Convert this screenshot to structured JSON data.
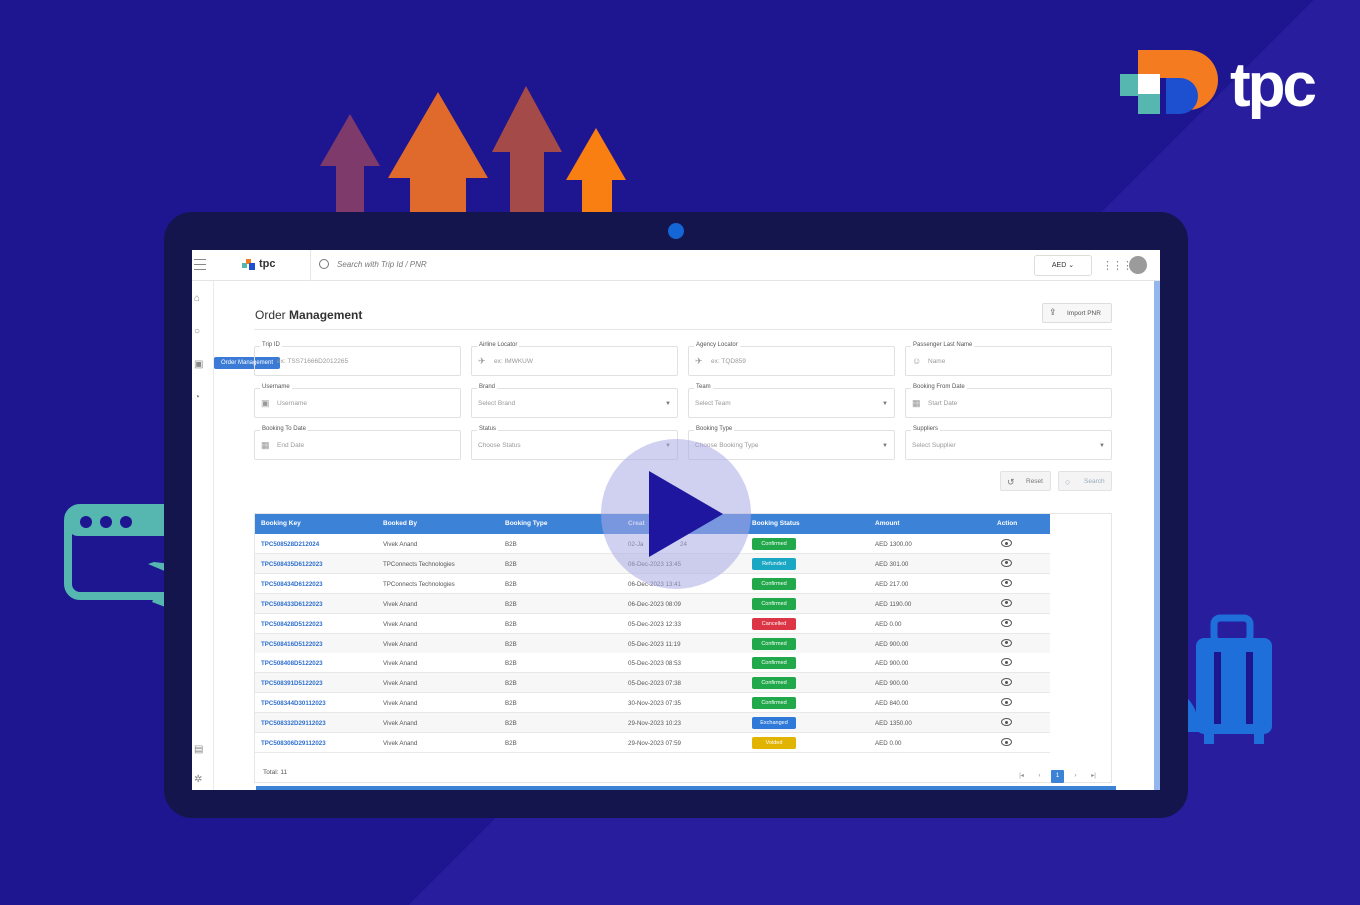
{
  "brand": {
    "name": "tpc"
  },
  "app": {
    "logo_text": "tpc",
    "search_placeholder": "Search with Trip Id / PNR",
    "currency": "AED",
    "page_title_prefix": "Order",
    "page_title": "Management",
    "import_label": "Import PNR",
    "tooltip": "Order Management"
  },
  "filters": {
    "trip_id": {
      "label": "Trip ID",
      "value": "ex: TSS71666D2012265"
    },
    "airline_locator": {
      "label": "Airline Locator",
      "value": "ex: IMWKUW"
    },
    "agency_locator": {
      "label": "Agency Locator",
      "value": "ex: TQD859"
    },
    "passenger": {
      "label": "Passenger Last Name",
      "value": "Name"
    },
    "username": {
      "label": "Username",
      "value": "Username"
    },
    "brand": {
      "label": "Brand",
      "value": "Select Brand"
    },
    "team": {
      "label": "Team",
      "value": "Select Team"
    },
    "from_date": {
      "label": "Booking From Date",
      "value": "Start Date"
    },
    "to_date": {
      "label": "Booking To Date",
      "value": "End Date"
    },
    "status": {
      "label": "Status",
      "value": "Choose Status"
    },
    "booking_type": {
      "label": "Booking Type",
      "value": "Choose Booking Type"
    },
    "suppliers": {
      "label": "Suppliers",
      "value": "Select Supplier"
    }
  },
  "buttons": {
    "reset": "Reset",
    "search": "Search"
  },
  "table": {
    "headers": [
      "Booking Key",
      "Booked By",
      "Booking Type",
      "Creat",
      "Booking Status",
      "Amount",
      "Action"
    ],
    "rows": [
      {
        "key": "TPC508528D212024",
        "by": "Vivek Anand",
        "type": "B2B",
        "created": "02-Ja",
        "created_tail": "24",
        "status": "Confirmed",
        "amount": "AED 1300.00"
      },
      {
        "key": "TPC508435D6122023",
        "by": "TPConnects Technologies",
        "type": "B2B",
        "created": "06-Dec-2023 13:45",
        "status": "Refunded",
        "amount": "AED 301.00"
      },
      {
        "key": "TPC508434D6122023",
        "by": "TPConnects Technologies",
        "type": "B2B",
        "created": "06-Dec-2023 13:41",
        "status": "Confirmed",
        "amount": "AED 217.00"
      },
      {
        "key": "TPC508433D6122023",
        "by": "Vivek Anand",
        "type": "B2B",
        "created": "06-Dec-2023 08:09",
        "status": "Confirmed",
        "amount": "AED 1190.00"
      },
      {
        "key": "TPC508428D5122023",
        "by": "Vivek Anand",
        "type": "B2B",
        "created": "05-Dec-2023 12:33",
        "status": "Cancelled",
        "amount": "AED 0.00"
      },
      {
        "key": "TPC508416D5122023",
        "by": "Vivek Anand",
        "type": "B2B",
        "created": "05-Dec-2023 11:19",
        "status": "Confirmed",
        "amount": "AED 900.00"
      },
      {
        "key": "TPC508408D5122023",
        "by": "Vivek Anand",
        "type": "B2B",
        "created": "05-Dec-2023 08:53",
        "status": "Confirmed",
        "amount": "AED 900.00"
      },
      {
        "key": "TPC508391D5122023",
        "by": "Vivek Anand",
        "type": "B2B",
        "created": "05-Dec-2023 07:38",
        "status": "Confirmed",
        "amount": "AED 900.00"
      },
      {
        "key": "TPC508344D30112023",
        "by": "Vivek Anand",
        "type": "B2B",
        "created": "30-Nov-2023 07:35",
        "status": "Confirmed",
        "amount": "AED 840.00"
      },
      {
        "key": "TPC508332D29112023",
        "by": "Vivek Anand",
        "type": "B2B",
        "created": "29-Nov-2023 10:23",
        "status": "Exchanged",
        "amount": "AED 1350.00"
      },
      {
        "key": "TPC508306D29112023",
        "by": "Vivek Anand",
        "type": "B2B",
        "created": "29-Nov-2023 07:59",
        "status": "Voided",
        "amount": "AED 0.00"
      }
    ],
    "total": "Total: 11",
    "current_page": "1"
  },
  "status_colors": {
    "Confirmed": "#21a84a",
    "Refunded": "#1aa7c4",
    "Cancelled": "#dc3545",
    "Exchanged": "#2f7ad8",
    "Voided": "#e0b400"
  },
  "accent": "#3c82d7"
}
